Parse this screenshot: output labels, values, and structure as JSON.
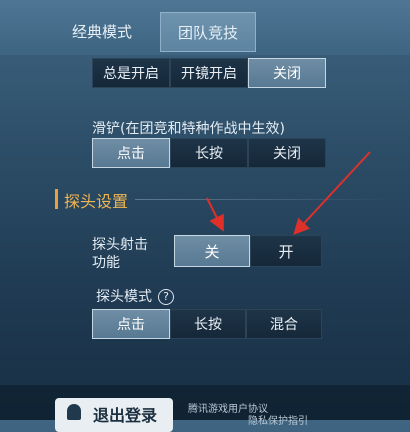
{
  "tabs": [
    {
      "label": "经典模式"
    },
    {
      "label": "团队竞技"
    }
  ],
  "scope": {
    "options": [
      "总是开启",
      "开镜开启",
      "关闭"
    ],
    "selected": "关闭"
  },
  "slide": {
    "label": "滑铲(在团竞和特种作战中生效)",
    "options": [
      "点击",
      "长按",
      "关闭"
    ],
    "selected": "点击"
  },
  "peek_section": {
    "title": "探头设置"
  },
  "peek_fire": {
    "label_line1": "探头射击",
    "label_line2": "功能",
    "options": [
      "关",
      "开"
    ],
    "selected": "关"
  },
  "peek_mode": {
    "label": "探头模式",
    "help_glyph": "?",
    "options": [
      "点击",
      "长按",
      "混合"
    ],
    "selected": "点击"
  },
  "footer": {
    "logout_label": "退出登录",
    "link1": "腾讯游戏用户协议",
    "link2": "隐私保护指引"
  },
  "colors": {
    "accent": "#f0b550",
    "arrow": "#e0302a"
  }
}
